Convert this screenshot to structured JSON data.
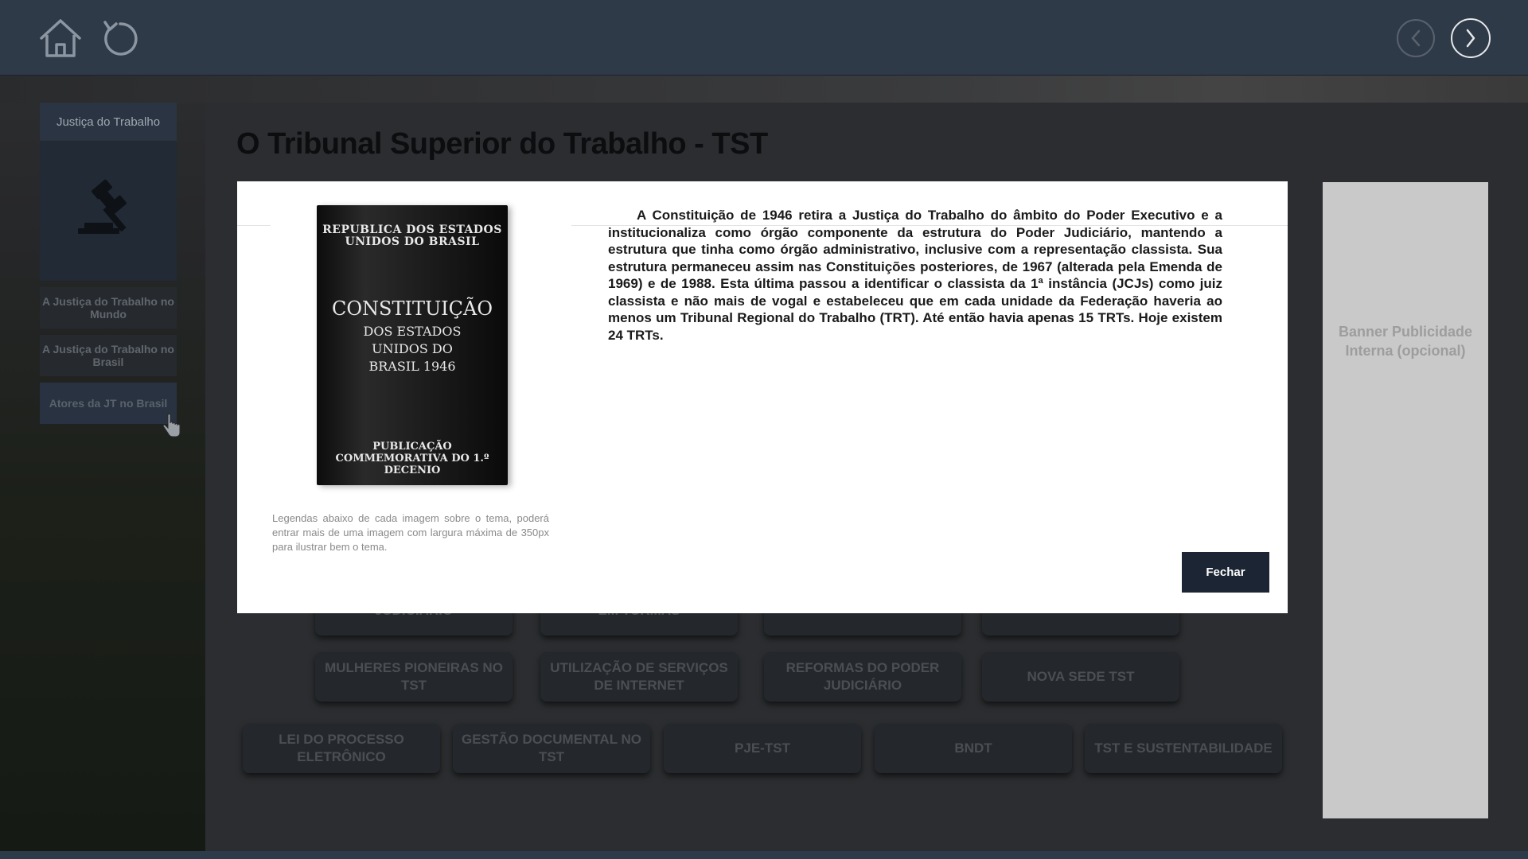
{
  "sidebar": {
    "title": "Justiça do Trabalho",
    "items": [
      {
        "label": "A Justiça do Trabalho no Mundo"
      },
      {
        "label": "A Justiça do Trabalho no Brasil"
      },
      {
        "label": "Atores da JT no Brasil"
      }
    ]
  },
  "page": {
    "title": "O Tribunal Superior do Trabalho - TST"
  },
  "banner": {
    "text": "Banner Publicidade Interna (opcional)"
  },
  "grid_buttons": {
    "row1": [
      "JUDICIÁRIO",
      "EM TURMAS",
      "",
      ""
    ],
    "row2": [
      "MULHERES PIONEIRAS NO TST",
      "UTILIZAÇÃO DE SERVIÇOS DE INTERNET",
      "REFORMAS DO PODER JUDICIÁRIO",
      "NOVA SEDE TST"
    ],
    "row3": [
      "LEI DO PROCESSO ELETRÔNICO",
      "GESTÃO DOCUMENTAL NO TST",
      "PJE-TST",
      "BNDT",
      "TST E SUSTENTABILIDADE"
    ]
  },
  "modal": {
    "book": {
      "line1": "REPUBLICA DOS ESTADOS UNIDOS DO BRASIL",
      "line2": "CONSTITUIÇÃO",
      "line3": "DOS ESTADOS UNIDOS DO BRASIL 1946",
      "line4": "PUBLICAÇÃO COMMEMORATIVA DO 1.º DECENIO"
    },
    "caption": "Legendas abaixo de cada imagem sobre o tema, poderá entrar mais de uma imagem com largura máxima de 350px para ilustrar bem o tema.",
    "body": "A Constituição de 1946 retira a Justiça do Trabalho do âmbito do Poder Executivo e a institucionaliza como órgão componente da estrutura do Poder Judiciário, mantendo a estrutura que tinha como órgão administrativo, inclusive com a representação classista. Sua estrutura permaneceu assim nas Constituições posteriores, de 1967 (alterada pela Emenda de 1969) e de 1988. Esta última passou a identificar o classista da 1ª instância (JCJs) como juiz classista e não mais de vogal e estabeleceu que em cada unidade da Federação haveria ao menos um Tribunal Regional do Trabalho (TRT). Até então havia apenas 15 TRTs. Hoje existem 24 TRTs.",
    "close_label": "Fechar"
  },
  "icons": {
    "home": "home-icon",
    "refresh": "refresh-icon",
    "prev": "chevron-left-icon",
    "next": "chevron-right-icon",
    "gavel": "gavel-icon"
  }
}
